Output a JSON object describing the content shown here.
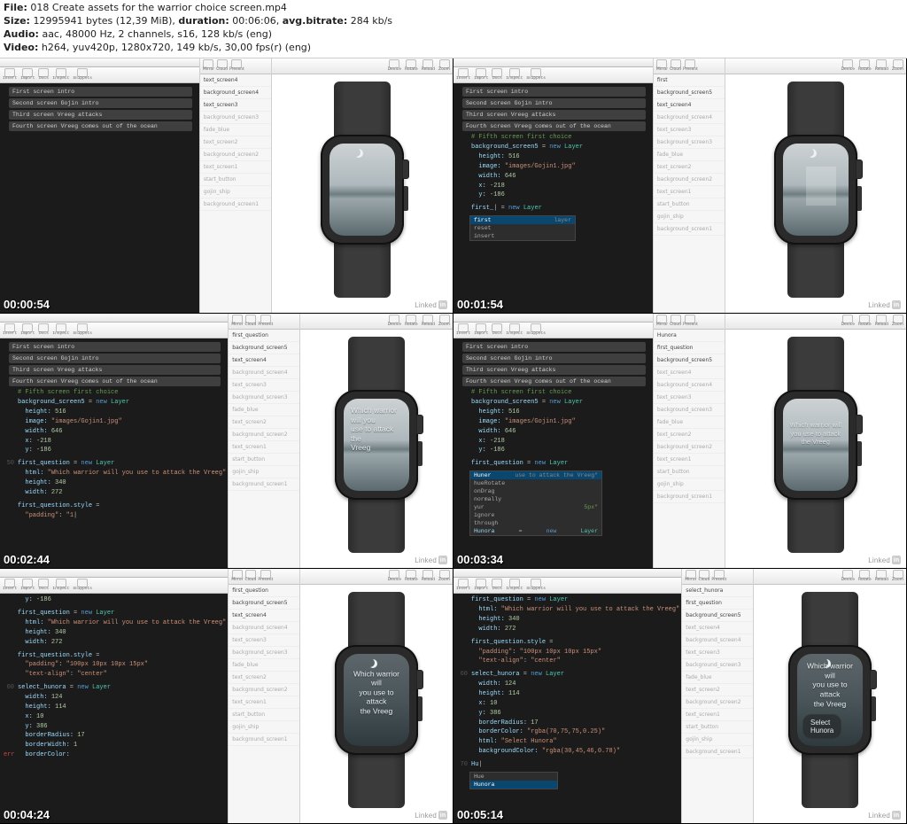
{
  "header": {
    "file_label": "File:",
    "file": "018 Create assets for the warrior choice screen.mp4",
    "size_label": "Size:",
    "size_bytes": "12995941 bytes (12,39 MiB)",
    "duration_label": "duration:",
    "duration": "00:06:06",
    "avg_bitrate_label": "avg.bitrate:",
    "avg_bitrate": "284 kb/s",
    "audio_label": "Audio:",
    "audio": "aac, 48000 Hz, 2 channels, s16, 128 kb/s (eng)",
    "video_label": "Video:",
    "video": "h264, yuv420p, 1280x720, 149 kb/s, 30,00 fps(r) (eng)"
  },
  "toolbar": {
    "left": [
      "Insert",
      "Import",
      "Docs",
      "Inspect",
      "Snippets"
    ],
    "mid": [
      "Mirror",
      "Cloud",
      "Present"
    ],
    "right": [
      "Device",
      "Rotate",
      "Reload",
      "Zoom"
    ]
  },
  "folds": {
    "f1": "First screen intro",
    "f2": "Second screen Gojin intro",
    "f3": "Third screen Vreeg attacks",
    "f4": "Fourth screen Vreeg comes out of the ocean"
  },
  "layers_base": [
    "text_screen4",
    "background_screen4",
    "text_screen3",
    "background_screen3",
    "fade_blue",
    "text_screen2",
    "background_screen2",
    "text_screen1",
    "start_button",
    "gojin_ship",
    "background_screen1"
  ],
  "layers_extra": [
    "select_hunora",
    "first_question",
    "background_screen5",
    "Hunora"
  ],
  "code": {
    "comment5": "# Fifth screen first choice",
    "bg": "background_screen5 = new Layer",
    "h516": "height: 516",
    "img": "image: \"images/Gojin1.jpg\"",
    "w646": "width: 646",
    "x218": "x: -218",
    "y186": "y: -186",
    "firstnew": "first_| = new Layer",
    "fq": "first_question = new Layer",
    "html_q": "html: \"Which warrior will you use to attack the Vreeg\"",
    "h340": "height: 340",
    "w272": "width: 272",
    "style": "first_question.style =",
    "pad": "\"padding\": \"100px 10px 10px 15px\"",
    "talign": "\"text-align\": \"center\"",
    "padshort": "\"padding\": \"1|",
    "sel": "select_hunora = new Layer",
    "w124": "width: 124",
    "h114": "height: 114",
    "x10": "x: 10",
    "y386": "y: 386",
    "br": "borderRadius: 17",
    "bw": "borderWidth: 1",
    "bc0": "borderColor:",
    "bc": "borderColor: \"rgba(70,75,75,0.25)\"",
    "htmlsel": "html: \"Select Hunora\"",
    "bgc": "backgroundColor: \"rgba(30,45,46,0.78)\"",
    "hun": "Hunora = new Layer"
  },
  "ac1": {
    "items": [
      "first",
      "reset",
      "insert"
    ],
    "tag": "layer"
  },
  "ac2": {
    "items": [
      "Huner",
      "hueRotate",
      "onDrag",
      "normally",
      "yur",
      "ignore",
      "through",
      "Hunora = new Layer"
    ],
    "hint": "use to attack the Vreeg\"",
    "px": "5px\""
  },
  "ac3": {
    "items": [
      "Hue",
      "Hunora"
    ]
  },
  "watch_text": {
    "q": "Which warrior will\nyou use to attack\nthe Vreeg",
    "q_top": "Which warrior will you\nuse to attack the\nVreeg",
    "sel": "Select\nHunora"
  },
  "timestamps": [
    "00:00:54",
    "00:01:54",
    "00:02:44",
    "00:03:34",
    "00:04:24",
    "00:05:14"
  ],
  "brand": "Linked"
}
